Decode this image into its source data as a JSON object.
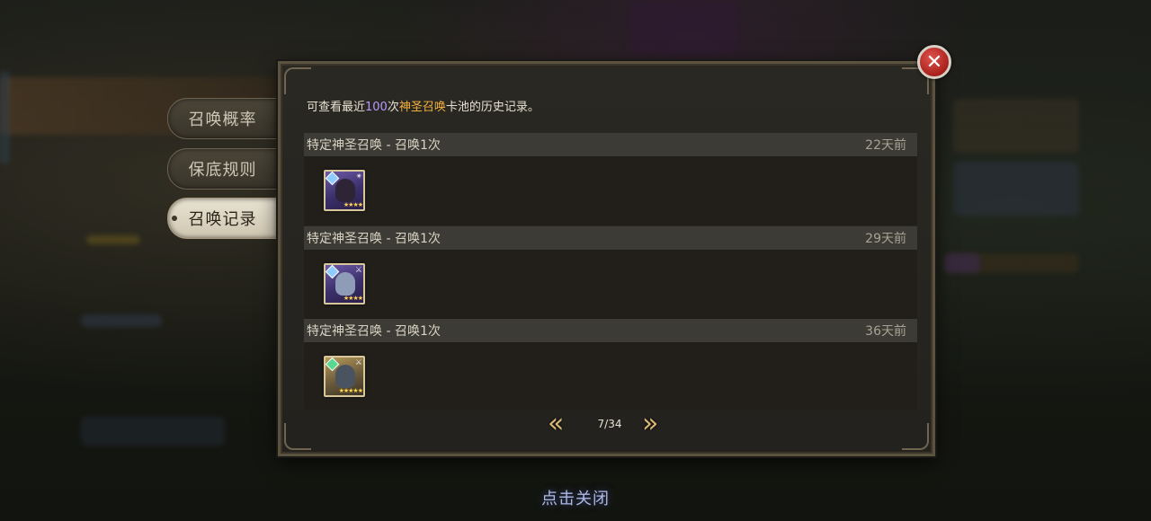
{
  "tabs": [
    {
      "label": "召唤概率",
      "active": false
    },
    {
      "label": "保底规则",
      "active": false
    },
    {
      "label": "召唤记录",
      "active": true
    }
  ],
  "intro": {
    "prefix": "可查看最近",
    "count": "100",
    "mid": "次",
    "pool": "神圣召唤",
    "suffix": "卡池的历史记录。"
  },
  "entries": [
    {
      "title": "特定神圣召唤 - 召唤1次",
      "ago": "22天前",
      "hero": {
        "frame": "purple",
        "stars": "★★★★",
        "element_icon": "ice-element-icon",
        "class_icon": "class-icon"
      }
    },
    {
      "title": "特定神圣召唤 - 召唤1次",
      "ago": "29天前",
      "hero": {
        "frame": "purple",
        "stars": "★★★★",
        "element_icon": "ice-element-icon",
        "class_icon": "class-icon"
      }
    },
    {
      "title": "特定神圣召唤 - 召唤1次",
      "ago": "36天前",
      "hero": {
        "frame": "gold",
        "stars": "★★★★★",
        "element_icon": "wind-element-icon",
        "class_icon": "class-icon"
      }
    }
  ],
  "pager": {
    "page": "7/34",
    "prev_icon": "double-chevron-left-icon",
    "next_icon": "double-chevron-right-icon"
  },
  "close_hint": "点击关闭",
  "colors": {
    "count": "#b999ff",
    "pool": "#f5b13d",
    "arrow": "#d9b877"
  }
}
